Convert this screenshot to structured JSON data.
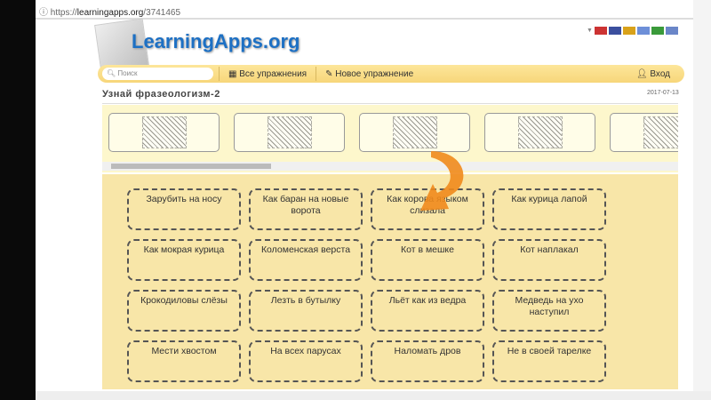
{
  "browser": {
    "url_prefix": "https://",
    "url_host": "learningapps.org",
    "url_path": "/3741465"
  },
  "site": {
    "logo": "LearningApps.org",
    "search_placeholder": "Поиск",
    "all_exercises": "Все упражнения",
    "new_exercise": "Новое упражнение",
    "login": "Вход"
  },
  "flags": [
    {
      "name": "de",
      "color": "#c33"
    },
    {
      "name": "en",
      "color": "#3b4f9e"
    },
    {
      "name": "es",
      "color": "#d9a21a"
    },
    {
      "name": "fr",
      "color": "#6d8fd8"
    },
    {
      "name": "it",
      "color": "#3a9a3a"
    },
    {
      "name": "ru",
      "color": "#6a86c8"
    }
  ],
  "exercise": {
    "title": "Узнай фразеологизм-2",
    "date": "2017-07-13"
  },
  "tiles": [
    "Зарубить на носу",
    "Как баран на новые ворота",
    "Как корова языком слизала",
    "Как курица лапой",
    "Как мокрая курица",
    "Коломенская верста",
    "Кот в мешке",
    "Кот наплакал",
    "Крокодиловы слёзы",
    "Лезть в бутылку",
    "Льёт как из ведра",
    "Медведь на ухо наступил",
    "Мести хвостом",
    "На всех парусах",
    "Наломать дров",
    "Не в своей тарелке"
  ],
  "colors": {
    "accent": "#1d70c4",
    "arrow": "#f08a1c"
  }
}
